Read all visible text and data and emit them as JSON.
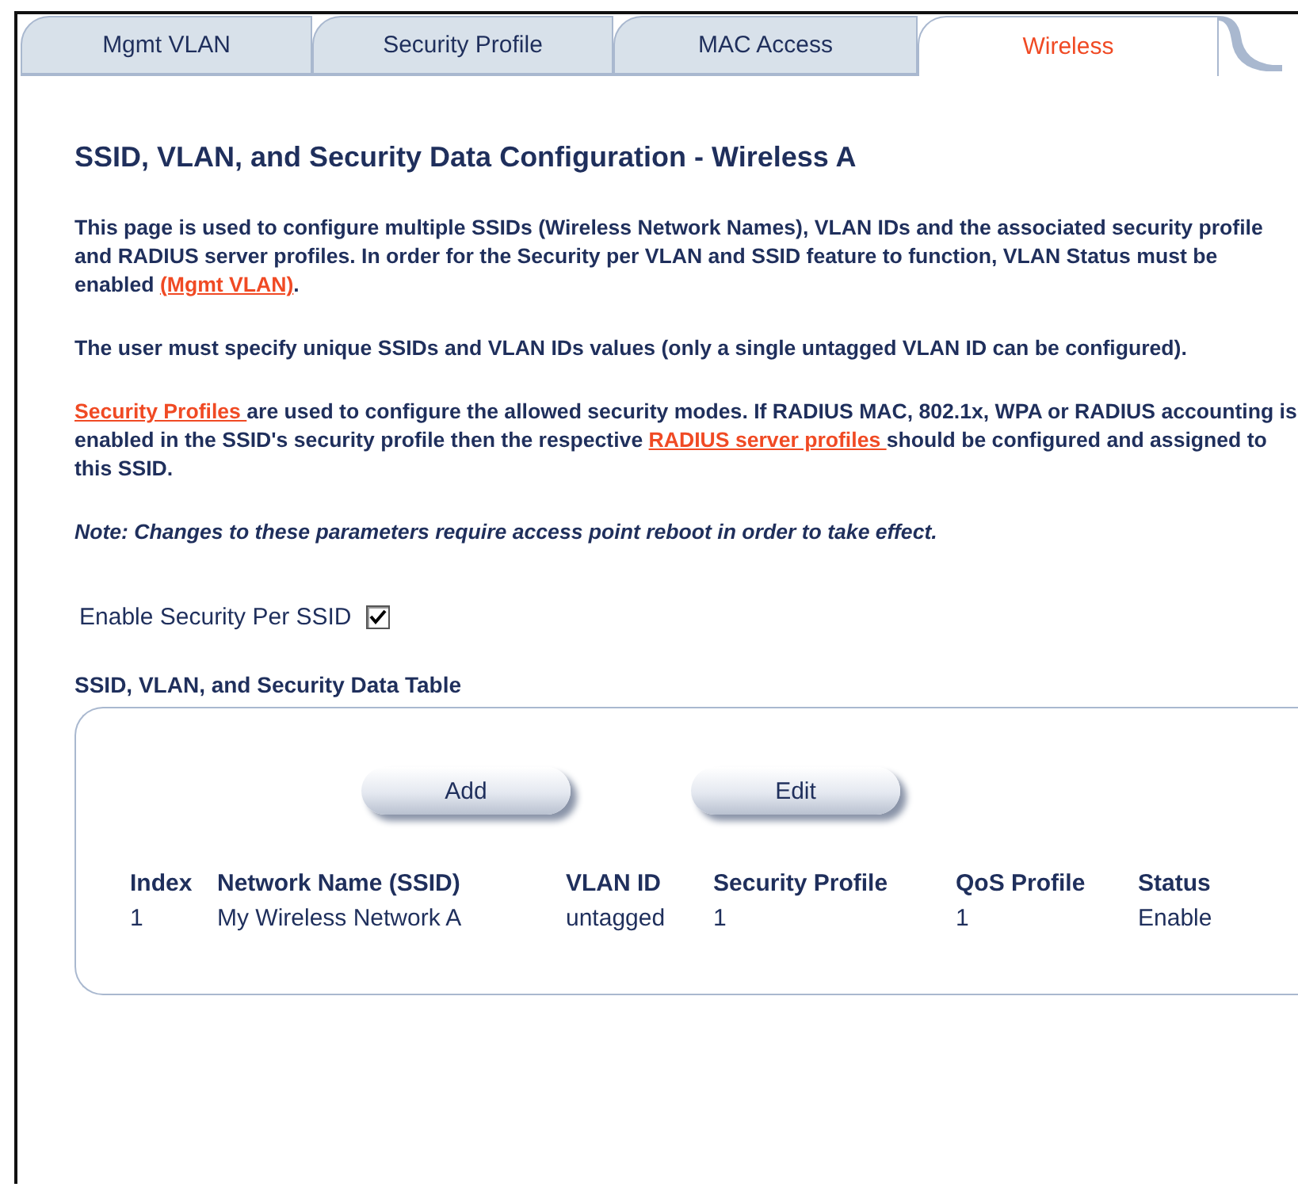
{
  "tabs": [
    {
      "label": "Mgmt VLAN",
      "selected": false
    },
    {
      "label": "Security Profile",
      "selected": false
    },
    {
      "label": "MAC Access",
      "selected": false
    },
    {
      "label": "Wireless",
      "selected": true
    }
  ],
  "heading": "SSID, VLAN, and Security Data Configuration - Wireless A",
  "paragraphs": [
    {
      "kind": "plain",
      "parts": [
        {
          "kind": "text",
          "text": "This page is used to configure multiple SSIDs (Wireless Network Names), VLAN IDs and the associated security profile and RADIUS server profiles. In order for the Security per VLAN and SSID feature to function, VLAN Status must be enabled "
        },
        {
          "kind": "link",
          "text": "(Mgmt VLAN)"
        },
        {
          "kind": "text",
          "text": "."
        }
      ]
    },
    {
      "kind": "plain",
      "parts": [
        {
          "kind": "text",
          "text": "The user must specify unique SSIDs and VLAN IDs values (only a single untagged VLAN ID can be configured)."
        }
      ]
    },
    {
      "kind": "plain",
      "parts": [
        {
          "kind": "link",
          "text": "Security Profiles "
        },
        {
          "kind": "text",
          "text": "are used to configure the allowed security modes. If RADIUS MAC, 802.1x, WPA or RADIUS accounting is enabled in the SSID's security profile then the respective "
        },
        {
          "kind": "link",
          "text": "RADIUS server profiles "
        },
        {
          "kind": "text",
          "text": "should be configured and assigned to this SSID."
        }
      ]
    },
    {
      "kind": "note",
      "parts": [
        {
          "kind": "text",
          "text": "Note: Changes to these parameters require access point reboot in order to take effect."
        }
      ]
    }
  ],
  "enable_security": {
    "label": "Enable Security Per SSID",
    "checked": true
  },
  "table_title": "SSID, VLAN, and Security Data Table",
  "buttons": [
    "Add",
    "Edit"
  ],
  "table": {
    "columns": [
      "Index",
      "Network Name (SSID)",
      "VLAN ID",
      "Security Profile",
      "QoS Profile",
      "Status"
    ],
    "rows": [
      [
        "1",
        "My Wireless Network A",
        "untagged",
        "1",
        "1",
        "Enable"
      ]
    ]
  }
}
